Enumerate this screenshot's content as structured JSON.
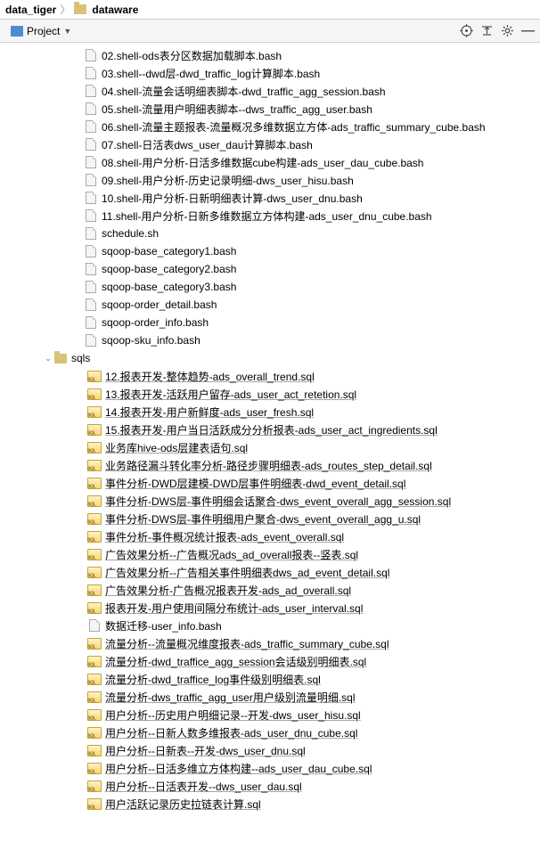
{
  "breadcrumb": {
    "parent": "data_tiger",
    "current": "dataware"
  },
  "toolbar": {
    "project_label": "Project"
  },
  "files_group1": [
    "02.shell-ods表分区数据加载脚本.bash",
    "03.shell--dwd层-dwd_traffic_log计算脚本.bash",
    "04.shell-流量会话明细表脚本-dwd_traffic_agg_session.bash",
    "05.shell-流量用户明细表脚本--dws_traffic_agg_user.bash",
    "06.shell-流量主题报表-流量概况多维数据立方体-ads_traffic_summary_cube.bash",
    "07.shell-日活表dws_user_dau计算脚本.bash",
    "08.shell-用户分析-日活多维数据cube构建-ads_user_dau_cube.bash",
    "09.shell-用户分析-历史记录明细-dws_user_hisu.bash",
    "10.shell-用户分析-日新明细表计算-dws_user_dnu.bash",
    "11.shell-用户分析-日新多维数据立方体构建-ads_user_dnu_cube.bash",
    "schedule.sh",
    "sqoop-base_category1.bash",
    "sqoop-base_category2.bash",
    "sqoop-base_category3.bash",
    "sqoop-order_detail.bash",
    "sqoop-order_info.bash",
    "sqoop-sku_info.bash"
  ],
  "folder2": "sqls",
  "files_group2": [
    "12.报表开发-整体趋势-ads_overall_trend.sql",
    "13.报表开发-活跃用户留存-ads_user_act_retetion.sql",
    "14.报表开发-用户新鲜度-ads_user_fresh.sql",
    "15.报表开发-用户当日活跃成分分析报表-ads_user_act_ingredients.sql",
    "业务库hive-ods层建表语句.sql",
    "业务路径漏斗转化率分析-路径步骤明细表-ads_routes_step_detail.sql",
    "事件分析-DWD层建模-DWD层事件明细表-dwd_event_detail.sql",
    "事件分析-DWS层-事件明细会话聚合-dws_event_overall_agg_session.sql",
    "事件分析-DWS层-事件明细用户聚合-dws_event_overall_agg_u.sql",
    "事件分析-事件概况统计报表-ads_event_overall.sql",
    "广告效果分析--广告概况ads_ad_overall报表--竖表.sql",
    "广告效果分析--广告相关事件明细表dws_ad_event_detail.sql",
    "广告效果分析-广告概况报表开发-ads_ad_overall.sql",
    "报表开发-用户使用间隔分布统计-ads_user_interval.sql",
    "数据迁移-user_info.bash",
    "流量分析--流量概况维度报表-ads_traffic_summary_cube.sql",
    "流量分析-dwd_traffice_agg_session会话级别明细表.sql",
    "流量分析-dwd_traffice_log事件级别明细表.sql",
    "流量分析-dws_traffic_agg_user用户级别流量明细.sql",
    "用户分析--历史用户明细记录--开发-dws_user_hisu.sql",
    "用户分析--日新人数多维报表-ads_user_dnu_cube.sql",
    "用户分析--日新表--开发-dws_user_dnu.sql",
    "用户分析--日活多维立方体构建--ads_user_dau_cube.sql",
    "用户分析--日活表开发--dws_user_dau.sql",
    "用户活跃记录历史拉链表计算.sql"
  ]
}
